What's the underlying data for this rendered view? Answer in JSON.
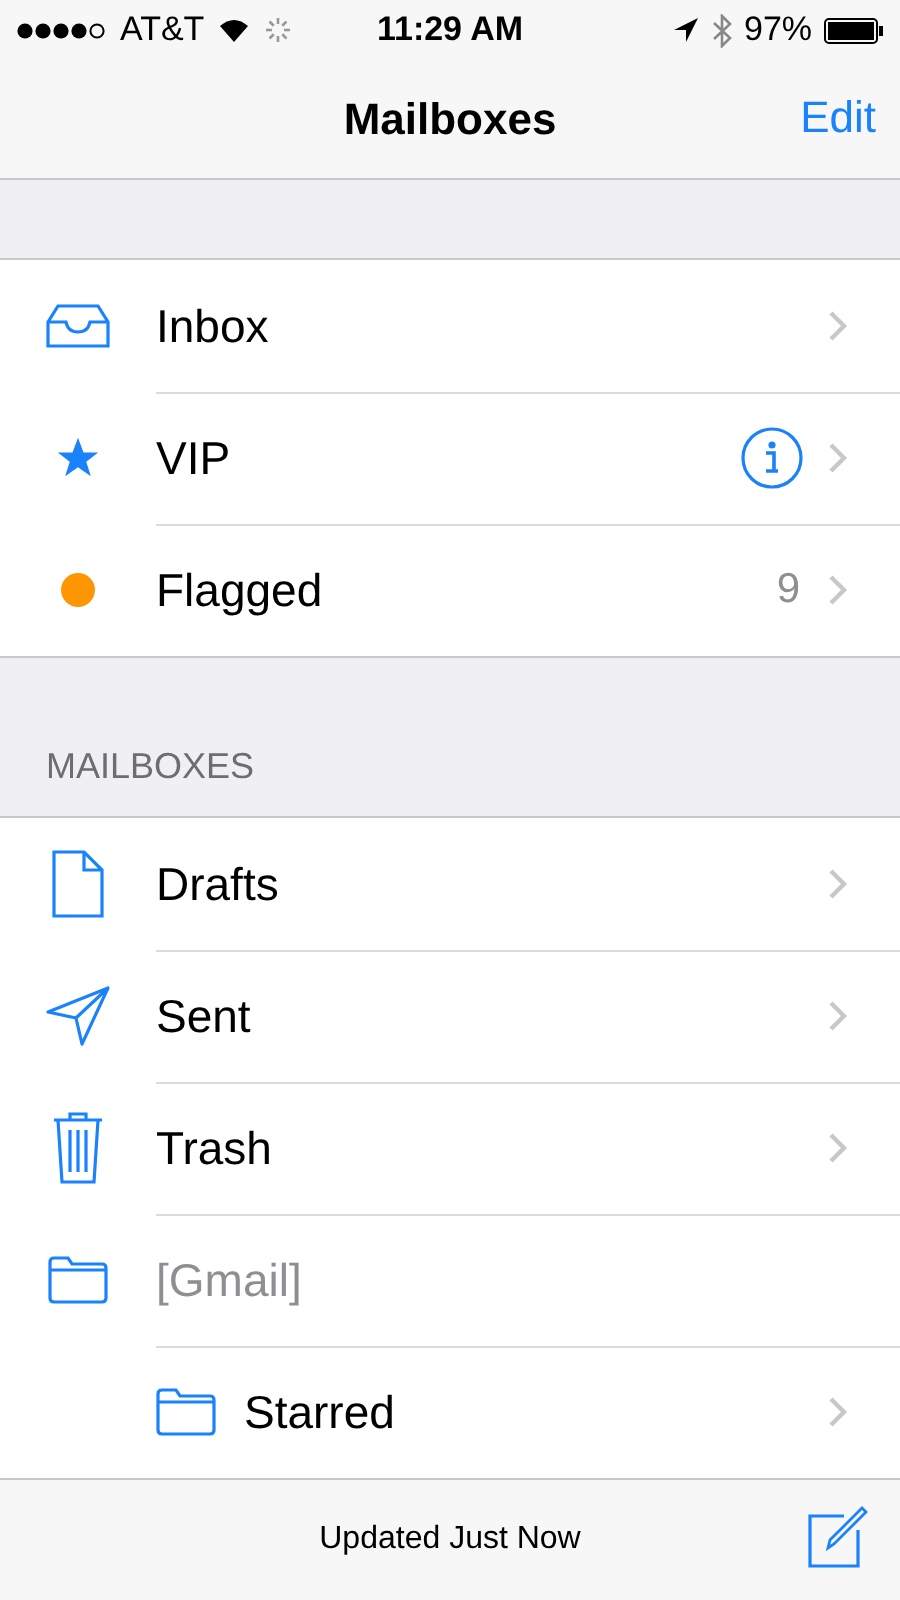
{
  "status_bar": {
    "carrier": "AT&T",
    "time": "11:29 AM",
    "battery": "97%"
  },
  "nav_bar": {
    "title": "Mailboxes",
    "edit": "Edit"
  },
  "favorites": [
    {
      "kind": "inbox",
      "label": "Inbox",
      "disabled": false
    },
    {
      "kind": "vip",
      "label": "VIP",
      "info": true,
      "disabled": false
    },
    {
      "kind": "flagged",
      "label": "Flagged",
      "count": "9",
      "disabled": false
    }
  ],
  "mailboxes_header": "MAILBOXES",
  "mailboxes": [
    {
      "kind": "drafts",
      "label": "Drafts",
      "disabled": false
    },
    {
      "kind": "sent",
      "label": "Sent",
      "disabled": false
    },
    {
      "kind": "trash",
      "label": "Trash",
      "disabled": false
    },
    {
      "kind": "folder",
      "label": "[Gmail]",
      "disabled": true,
      "children": [
        {
          "kind": "folder",
          "label": "Starred",
          "disabled": false
        }
      ]
    }
  ],
  "toolbar": {
    "status": "Updated Just Now"
  }
}
